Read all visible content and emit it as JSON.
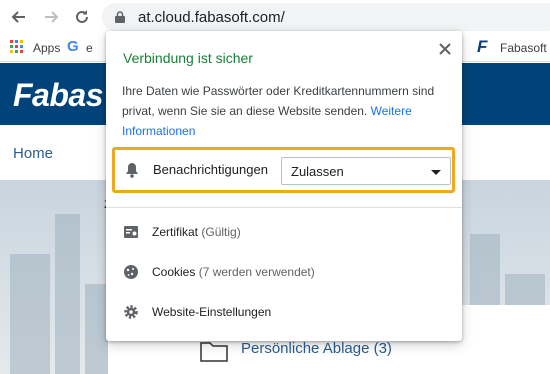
{
  "browser": {
    "url": "at.cloud.fabasoft.com/",
    "bookmarks": {
      "apps_label": "Apps",
      "google_partial": "e",
      "fabasoft_label": "Fabasoft"
    }
  },
  "page": {
    "logo_text": "Fabas",
    "nav_home": "Home",
    "stray_char": "z",
    "folder_label": "Persönliche Ablage (3)"
  },
  "site_info": {
    "title": "Verbindung ist sicher",
    "description": "Ihre Daten wie Passwörter oder Kreditkartennummern sind privat, wenn Sie sie an diese Website senden.",
    "more_link": "Weitere Informationen",
    "notifications": {
      "label": "Benachrichtigungen",
      "value": "Zulassen"
    },
    "certificate": {
      "label": "Zertifikat",
      "status": "(Gültig)"
    },
    "cookies": {
      "label": "Cookies",
      "status": "(7 werden verwendet)"
    },
    "site_settings": {
      "label": "Website-Einstellungen"
    }
  },
  "colors": {
    "header_blue": "#00437a",
    "secure_green": "#188038",
    "link_blue": "#1a73e8",
    "highlight_orange": "#f0a81e"
  }
}
